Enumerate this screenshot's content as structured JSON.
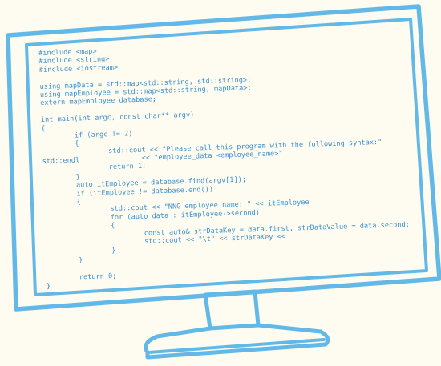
{
  "colors": {
    "background": "#fefcf0",
    "monitor_stroke": "#62b9e8",
    "code_text": "#3a8fd0"
  },
  "icons": {
    "monitor": "monitor-icon"
  },
  "code": {
    "lines": [
      "#include <map>",
      "#include <string>",
      "#include <iostream>",
      "",
      "using mapData = std::map<std::string, std::string>;",
      "using mapEmployee = std::map<std::string, mapData>;",
      "extern mapEmployee database;",
      "",
      "int main(int argc, const char** argv)",
      "{",
      "        if (argc != 2)",
      "        {",
      "                std::cout << \"Please call this program with the following syntax:\"",
      "std::endl               << \"employee_data <employee_name>\"",
      "                return 1;",
      "        }",
      "        auto itEmployee = database.find(argv[1]);",
      "        if (itEmployee != database.end())",
      "        {",
      "                std::cout << \"NNG employee name: \" << itEmployee",
      "                for (auto data : itEmployee->second)",
      "                {",
      "                        const auto& strDataKey = data.first, strDataValue = data.second;",
      "                        std::cout << \"\\t\" << strDataKey <<",
      "                }",
      "        }",
      "",
      "        return 0;",
      "}"
    ]
  }
}
